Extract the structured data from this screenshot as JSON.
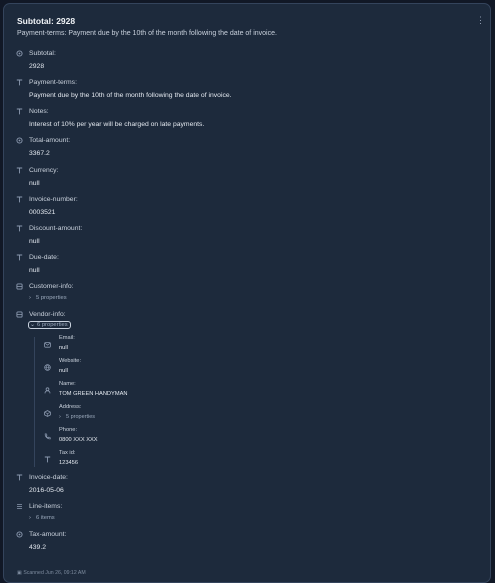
{
  "header": {
    "title": "Subtotal: 2928",
    "subtitle": "Payment-terms: Payment due by the 10th of the month following the date of invoice."
  },
  "fields": [
    {
      "key": "subtotal",
      "label": "Subtotal:",
      "value": "2928",
      "icon": "number-icon"
    },
    {
      "key": "payment_terms",
      "label": "Payment-terms:",
      "value": "Payment due by the 10th of the month following the date of invoice.",
      "icon": "text-icon"
    },
    {
      "key": "notes",
      "label": "Notes:",
      "value": "Interest of 10% per year will be charged on late payments.",
      "icon": "text-icon"
    },
    {
      "key": "total_amount",
      "label": "Total-amount:",
      "value": "3367.2",
      "icon": "number-icon"
    },
    {
      "key": "currency",
      "label": "Currency:",
      "value": "null",
      "icon": "text-icon"
    },
    {
      "key": "invoice_number",
      "label": "Invoice-number:",
      "value": "0003521",
      "icon": "text-icon"
    },
    {
      "key": "discount_amount",
      "label": "Discount-amount:",
      "value": "null",
      "icon": "text-icon"
    },
    {
      "key": "due_date",
      "label": "Due-date:",
      "value": "null",
      "icon": "text-icon"
    },
    {
      "key": "customer_info",
      "label": "Customer-info:",
      "toggle": "5 properties",
      "icon": "object-icon"
    },
    {
      "key": "vendor_info",
      "label": "Vendor-info:",
      "toggle": "6 properties",
      "icon": "object-icon",
      "expanded": true
    },
    {
      "key": "invoice_date",
      "label": "Invoice-date:",
      "value": "2016-05-06",
      "icon": "text-icon"
    },
    {
      "key": "line_items",
      "label": "Line-items:",
      "toggle": "6 items",
      "icon": "list-icon"
    },
    {
      "key": "tax_amount",
      "label": "Tax-amount:",
      "value": "439.2",
      "icon": "number-icon"
    }
  ],
  "vendor": [
    {
      "label": "Email:",
      "value": "null",
      "icon": "mail-icon"
    },
    {
      "label": "Website:",
      "value": "null",
      "icon": "globe-icon"
    },
    {
      "label": "Name:",
      "value": "TOM GREEN HANDYMAN",
      "icon": "person-icon"
    },
    {
      "label": "Address:",
      "toggle": "5 properties",
      "icon": "address-icon"
    },
    {
      "label": "Phone:",
      "value": "0800 XXX XXX",
      "icon": "phone-icon"
    },
    {
      "label": "Tax id:",
      "value": "123456",
      "icon": "text-icon"
    }
  ],
  "footer": "Scanned Jun 26, 09:12 AM",
  "colors": {
    "background": "#111826",
    "card": "#1d2a3c",
    "border": "#34445c",
    "text": "#e4e9f0"
  }
}
